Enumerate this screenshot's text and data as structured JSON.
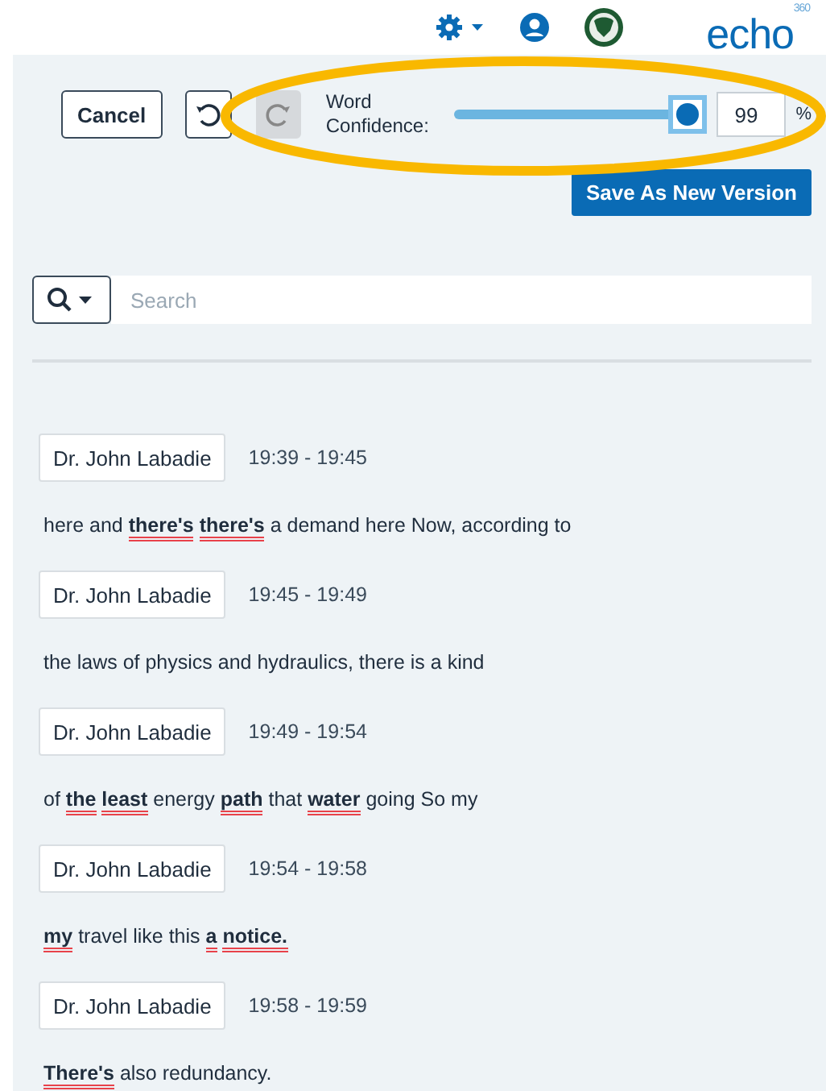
{
  "header": {
    "logo": "echo",
    "logo_badge": "360"
  },
  "toolbar": {
    "cancel": "Cancel",
    "undo": {
      "disabled": false
    },
    "redo": {
      "disabled": true
    },
    "confidence_label": "Word Confidence:",
    "confidence": {
      "level": 0.99,
      "value": "99",
      "unit": "%"
    },
    "save": "Save As New Version"
  },
  "search": {
    "placeholder": "Search"
  },
  "segments": [
    {
      "speaker": "Dr. John Labadie",
      "time": "19:39 - 19:45",
      "words": [
        {
          "text": "here and",
          "flagged": false
        },
        {
          "text": "there's",
          "flagged": true
        },
        {
          "text": "there's",
          "flagged": true
        },
        {
          "text": "a demand here Now, according to",
          "flagged": false
        }
      ]
    },
    {
      "speaker": "Dr. John Labadie",
      "time": "19:45 - 19:49",
      "words": [
        {
          "text": "the laws of physics and hydraulics, there is a kind",
          "flagged": false
        }
      ]
    },
    {
      "speaker": "Dr. John Labadie",
      "time": "19:49 - 19:54",
      "words": [
        {
          "text": "of",
          "flagged": false
        },
        {
          "text": "the",
          "flagged": true
        },
        {
          "text": "least",
          "flagged": true
        },
        {
          "text": "energy",
          "flagged": false
        },
        {
          "text": "path",
          "flagged": true
        },
        {
          "text": "that",
          "flagged": false
        },
        {
          "text": "water",
          "flagged": true
        },
        {
          "text": "going So my",
          "flagged": false
        }
      ]
    },
    {
      "speaker": "Dr. John Labadie",
      "time": "19:54 - 19:58",
      "words": [
        {
          "text": "my",
          "flagged": true
        },
        {
          "text": "travel like this",
          "flagged": false
        },
        {
          "text": "a",
          "flagged": true
        },
        {
          "text": "notice.",
          "flagged": true
        }
      ]
    },
    {
      "speaker": "Dr. John Labadie",
      "time": "19:58 - 19:59",
      "words": [
        {
          "text": "There's",
          "flagged": true
        },
        {
          "text": "also redundancy.",
          "flagged": false
        }
      ]
    }
  ]
}
